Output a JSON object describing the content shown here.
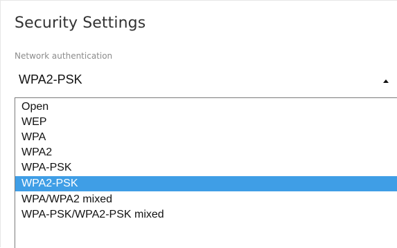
{
  "section": {
    "title": "Security Settings"
  },
  "network_authentication": {
    "label": "Network authentication",
    "selected_value": "WPA2-PSK",
    "options": [
      "Open",
      "WEP",
      "WPA",
      "WPA2",
      "WPA-PSK",
      "WPA2-PSK",
      "WPA/WPA2 mixed",
      "WPA-PSK/WPA2-PSK mixed"
    ],
    "highlighted_option": "WPA2-PSK"
  },
  "icons": {
    "dropdown_caret": "caret-up-icon"
  },
  "colors": {
    "highlight": "#3f9ee6",
    "highlight_text": "#ffffff",
    "text": "#111111",
    "label": "#8c8c8c",
    "title": "#333333"
  }
}
